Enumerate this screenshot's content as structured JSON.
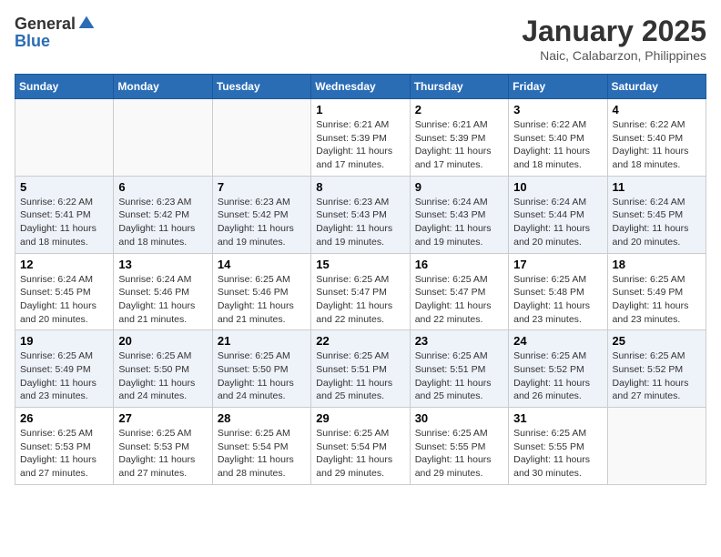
{
  "header": {
    "logo_general": "General",
    "logo_blue": "Blue",
    "month_title": "January 2025",
    "location": "Naic, Calabarzon, Philippines"
  },
  "weekdays": [
    "Sunday",
    "Monday",
    "Tuesday",
    "Wednesday",
    "Thursday",
    "Friday",
    "Saturday"
  ],
  "weeks": [
    [
      {
        "day": "",
        "info": ""
      },
      {
        "day": "",
        "info": ""
      },
      {
        "day": "",
        "info": ""
      },
      {
        "day": "1",
        "info": "Sunrise: 6:21 AM\nSunset: 5:39 PM\nDaylight: 11 hours and 17 minutes."
      },
      {
        "day": "2",
        "info": "Sunrise: 6:21 AM\nSunset: 5:39 PM\nDaylight: 11 hours and 17 minutes."
      },
      {
        "day": "3",
        "info": "Sunrise: 6:22 AM\nSunset: 5:40 PM\nDaylight: 11 hours and 18 minutes."
      },
      {
        "day": "4",
        "info": "Sunrise: 6:22 AM\nSunset: 5:40 PM\nDaylight: 11 hours and 18 minutes."
      }
    ],
    [
      {
        "day": "5",
        "info": "Sunrise: 6:22 AM\nSunset: 5:41 PM\nDaylight: 11 hours and 18 minutes."
      },
      {
        "day": "6",
        "info": "Sunrise: 6:23 AM\nSunset: 5:42 PM\nDaylight: 11 hours and 18 minutes."
      },
      {
        "day": "7",
        "info": "Sunrise: 6:23 AM\nSunset: 5:42 PM\nDaylight: 11 hours and 19 minutes."
      },
      {
        "day": "8",
        "info": "Sunrise: 6:23 AM\nSunset: 5:43 PM\nDaylight: 11 hours and 19 minutes."
      },
      {
        "day": "9",
        "info": "Sunrise: 6:24 AM\nSunset: 5:43 PM\nDaylight: 11 hours and 19 minutes."
      },
      {
        "day": "10",
        "info": "Sunrise: 6:24 AM\nSunset: 5:44 PM\nDaylight: 11 hours and 20 minutes."
      },
      {
        "day": "11",
        "info": "Sunrise: 6:24 AM\nSunset: 5:45 PM\nDaylight: 11 hours and 20 minutes."
      }
    ],
    [
      {
        "day": "12",
        "info": "Sunrise: 6:24 AM\nSunset: 5:45 PM\nDaylight: 11 hours and 20 minutes."
      },
      {
        "day": "13",
        "info": "Sunrise: 6:24 AM\nSunset: 5:46 PM\nDaylight: 11 hours and 21 minutes."
      },
      {
        "day": "14",
        "info": "Sunrise: 6:25 AM\nSunset: 5:46 PM\nDaylight: 11 hours and 21 minutes."
      },
      {
        "day": "15",
        "info": "Sunrise: 6:25 AM\nSunset: 5:47 PM\nDaylight: 11 hours and 22 minutes."
      },
      {
        "day": "16",
        "info": "Sunrise: 6:25 AM\nSunset: 5:47 PM\nDaylight: 11 hours and 22 minutes."
      },
      {
        "day": "17",
        "info": "Sunrise: 6:25 AM\nSunset: 5:48 PM\nDaylight: 11 hours and 23 minutes."
      },
      {
        "day": "18",
        "info": "Sunrise: 6:25 AM\nSunset: 5:49 PM\nDaylight: 11 hours and 23 minutes."
      }
    ],
    [
      {
        "day": "19",
        "info": "Sunrise: 6:25 AM\nSunset: 5:49 PM\nDaylight: 11 hours and 23 minutes."
      },
      {
        "day": "20",
        "info": "Sunrise: 6:25 AM\nSunset: 5:50 PM\nDaylight: 11 hours and 24 minutes."
      },
      {
        "day": "21",
        "info": "Sunrise: 6:25 AM\nSunset: 5:50 PM\nDaylight: 11 hours and 24 minutes."
      },
      {
        "day": "22",
        "info": "Sunrise: 6:25 AM\nSunset: 5:51 PM\nDaylight: 11 hours and 25 minutes."
      },
      {
        "day": "23",
        "info": "Sunrise: 6:25 AM\nSunset: 5:51 PM\nDaylight: 11 hours and 25 minutes."
      },
      {
        "day": "24",
        "info": "Sunrise: 6:25 AM\nSunset: 5:52 PM\nDaylight: 11 hours and 26 minutes."
      },
      {
        "day": "25",
        "info": "Sunrise: 6:25 AM\nSunset: 5:52 PM\nDaylight: 11 hours and 27 minutes."
      }
    ],
    [
      {
        "day": "26",
        "info": "Sunrise: 6:25 AM\nSunset: 5:53 PM\nDaylight: 11 hours and 27 minutes."
      },
      {
        "day": "27",
        "info": "Sunrise: 6:25 AM\nSunset: 5:53 PM\nDaylight: 11 hours and 27 minutes."
      },
      {
        "day": "28",
        "info": "Sunrise: 6:25 AM\nSunset: 5:54 PM\nDaylight: 11 hours and 28 minutes."
      },
      {
        "day": "29",
        "info": "Sunrise: 6:25 AM\nSunset: 5:54 PM\nDaylight: 11 hours and 29 minutes."
      },
      {
        "day": "30",
        "info": "Sunrise: 6:25 AM\nSunset: 5:55 PM\nDaylight: 11 hours and 29 minutes."
      },
      {
        "day": "31",
        "info": "Sunrise: 6:25 AM\nSunset: 5:55 PM\nDaylight: 11 hours and 30 minutes."
      },
      {
        "day": "",
        "info": ""
      }
    ]
  ]
}
